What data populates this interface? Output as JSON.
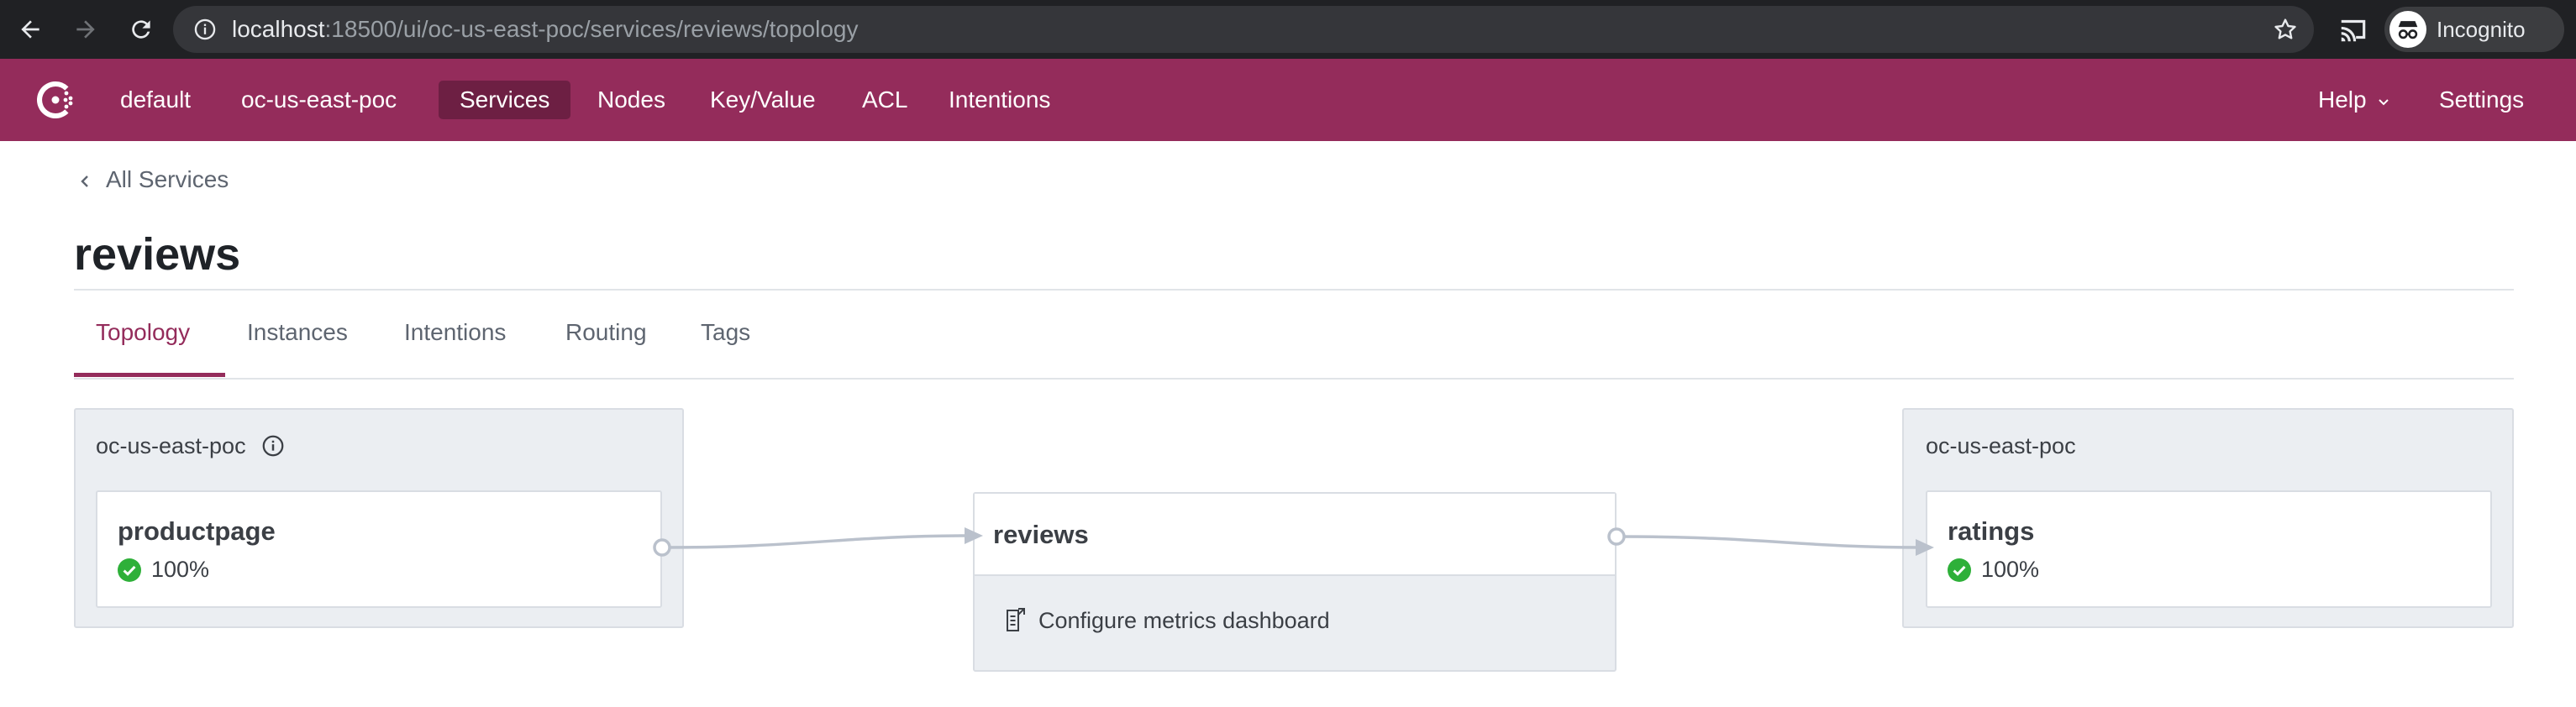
{
  "browser": {
    "url_host": "localhost",
    "url_path": ":18500/ui/oc-us-east-poc/services/reviews/topology",
    "profile_label": "Incognito",
    "icons": [
      "back-icon",
      "forward-icon",
      "reload-icon",
      "info-icon",
      "star-icon",
      "cast-icon",
      "incognito-icon"
    ]
  },
  "nav": {
    "items": [
      {
        "label": "default"
      },
      {
        "label": "oc-us-east-poc"
      },
      {
        "label": "Services"
      },
      {
        "label": "Nodes"
      },
      {
        "label": "Key/Value"
      },
      {
        "label": "ACL"
      },
      {
        "label": "Intentions"
      }
    ],
    "active": "Services",
    "help_label": "Help",
    "settings_label": "Settings",
    "colors": {
      "bar": "#942c5b",
      "active": "#6d1f43"
    }
  },
  "breadcrumb": {
    "label": "All Services"
  },
  "page": {
    "title": "reviews"
  },
  "tabs": {
    "items": [
      {
        "label": "Topology"
      },
      {
        "label": "Instances"
      },
      {
        "label": "Intentions"
      },
      {
        "label": "Routing"
      },
      {
        "label": "Tags"
      }
    ],
    "active": "Topology"
  },
  "topology": {
    "upstream_dc": {
      "label": "oc-us-east-poc",
      "service": {
        "name": "productpage",
        "health": "100%"
      }
    },
    "center": {
      "name": "reviews",
      "metrics_label": "Configure metrics dashboard"
    },
    "downstream_dc": {
      "label": "oc-us-east-poc",
      "service": {
        "name": "ratings",
        "health": "100%"
      }
    },
    "colors": {
      "healthy": "#2eb039",
      "link": "#bac1cc"
    }
  }
}
